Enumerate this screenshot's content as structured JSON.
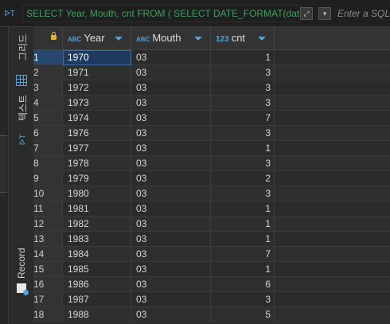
{
  "filter": {
    "icon": "filter-icon",
    "text": "SELECT Year, Mouth, cnt FROM ( SELECT DATE_FORMAT(date(p.`d",
    "hint": "Enter a SQL"
  },
  "sidebar": {
    "tabs": [
      {
        "label": "그리드",
        "icon": "grid-icon"
      },
      {
        "label": "텍스트",
        "icon": "text-icon"
      },
      {
        "label": "Record",
        "icon": "record-icon"
      }
    ]
  },
  "columns": [
    {
      "type": "ABC",
      "name": "Year"
    },
    {
      "type": "ABC",
      "name": "Mouth"
    },
    {
      "type": "123",
      "name": "cnt"
    }
  ],
  "rows": [
    {
      "n": "1",
      "year": "1970",
      "mouth": "03",
      "cnt": "1"
    },
    {
      "n": "2",
      "year": "1971",
      "mouth": "03",
      "cnt": "3"
    },
    {
      "n": "3",
      "year": "1972",
      "mouth": "03",
      "cnt": "3"
    },
    {
      "n": "4",
      "year": "1973",
      "mouth": "03",
      "cnt": "3"
    },
    {
      "n": "5",
      "year": "1974",
      "mouth": "03",
      "cnt": "7"
    },
    {
      "n": "6",
      "year": "1976",
      "mouth": "03",
      "cnt": "3"
    },
    {
      "n": "7",
      "year": "1977",
      "mouth": "03",
      "cnt": "1"
    },
    {
      "n": "8",
      "year": "1978",
      "mouth": "03",
      "cnt": "3"
    },
    {
      "n": "9",
      "year": "1979",
      "mouth": "03",
      "cnt": "2"
    },
    {
      "n": "10",
      "year": "1980",
      "mouth": "03",
      "cnt": "3"
    },
    {
      "n": "11",
      "year": "1981",
      "mouth": "03",
      "cnt": "1"
    },
    {
      "n": "12",
      "year": "1982",
      "mouth": "03",
      "cnt": "1"
    },
    {
      "n": "13",
      "year": "1983",
      "mouth": "03",
      "cnt": "1"
    },
    {
      "n": "14",
      "year": "1984",
      "mouth": "03",
      "cnt": "7"
    },
    {
      "n": "15",
      "year": "1985",
      "mouth": "03",
      "cnt": "1"
    },
    {
      "n": "16",
      "year": "1986",
      "mouth": "03",
      "cnt": "6"
    },
    {
      "n": "17",
      "year": "1987",
      "mouth": "03",
      "cnt": "3"
    },
    {
      "n": "18",
      "year": "1988",
      "mouth": "03",
      "cnt": "5"
    }
  ],
  "colors": {
    "accent": "#4fa3e0",
    "filter_text": "#3aa55d",
    "selection": "#1f3a5f"
  }
}
